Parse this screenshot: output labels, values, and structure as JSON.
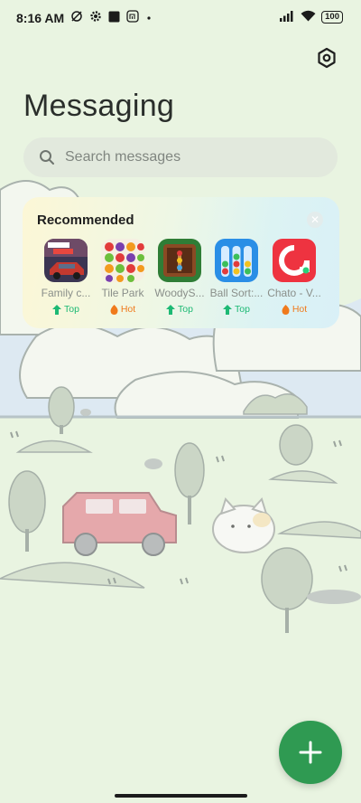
{
  "status_bar": {
    "time": "8:16 AM",
    "battery": "100",
    "icons": [
      "no-sync-icon",
      "settings-gear-icon",
      "square-icon",
      "mi-icon",
      "dot-icon",
      "signal-icon",
      "wifi-icon",
      "battery-icon"
    ]
  },
  "header": {
    "title": "Messaging",
    "settings_icon": "settings-hexagon-icon"
  },
  "search": {
    "placeholder": "Search messages",
    "icon": "search-icon"
  },
  "recommended": {
    "title": "Recommended",
    "close_icon": "close-icon",
    "apps": [
      {
        "name": "Family c...",
        "badge": "Top",
        "badge_type": "top"
      },
      {
        "name": "Tile Park",
        "badge": "Hot",
        "badge_type": "hot"
      },
      {
        "name": "WoodyS...",
        "badge": "Top",
        "badge_type": "top"
      },
      {
        "name": "Ball Sort:...",
        "badge": "Top",
        "badge_type": "top"
      },
      {
        "name": "Chato - V...",
        "badge": "Hot",
        "badge_type": "hot"
      }
    ]
  },
  "fab": {
    "icon": "plus-icon"
  },
  "colors": {
    "background": "#e9f4e1",
    "fab": "#2f9a52",
    "top_badge": "#1db974",
    "hot_badge": "#f07a1c"
  }
}
